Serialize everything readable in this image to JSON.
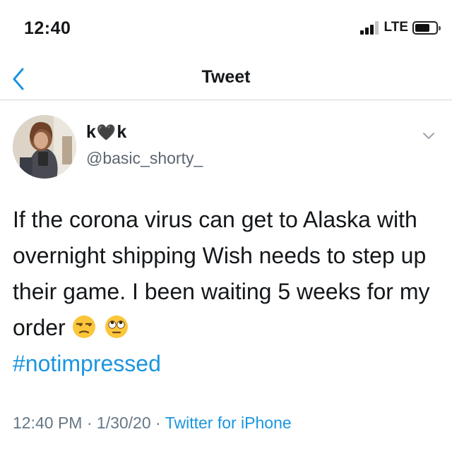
{
  "status_bar": {
    "time": "12:40",
    "network": "LTE",
    "signal_bars_filled": 3,
    "signal_bars_total": 4,
    "battery_level": 0.7
  },
  "nav": {
    "title": "Tweet",
    "back_icon": "chevron-left-icon"
  },
  "tweet": {
    "display_name_left": "k",
    "display_name_heart": "🖤",
    "display_name_right": "k",
    "username": "@basic_shorty_",
    "text": "If the corona virus can get to Alaska with overnight shipping Wish needs to step up their game. I been waiting 5 weeks for my order",
    "emojis": [
      "unamused-face-icon",
      "face-with-rolling-eyes-icon"
    ],
    "hashtag": "#notimpressed",
    "time": "12:40 PM",
    "separator": "·",
    "date": "1/30/20",
    "source": "Twitter for iPhone"
  },
  "colors": {
    "accent": "#1b95e0",
    "text": "#14171a",
    "secondary": "#657786"
  }
}
